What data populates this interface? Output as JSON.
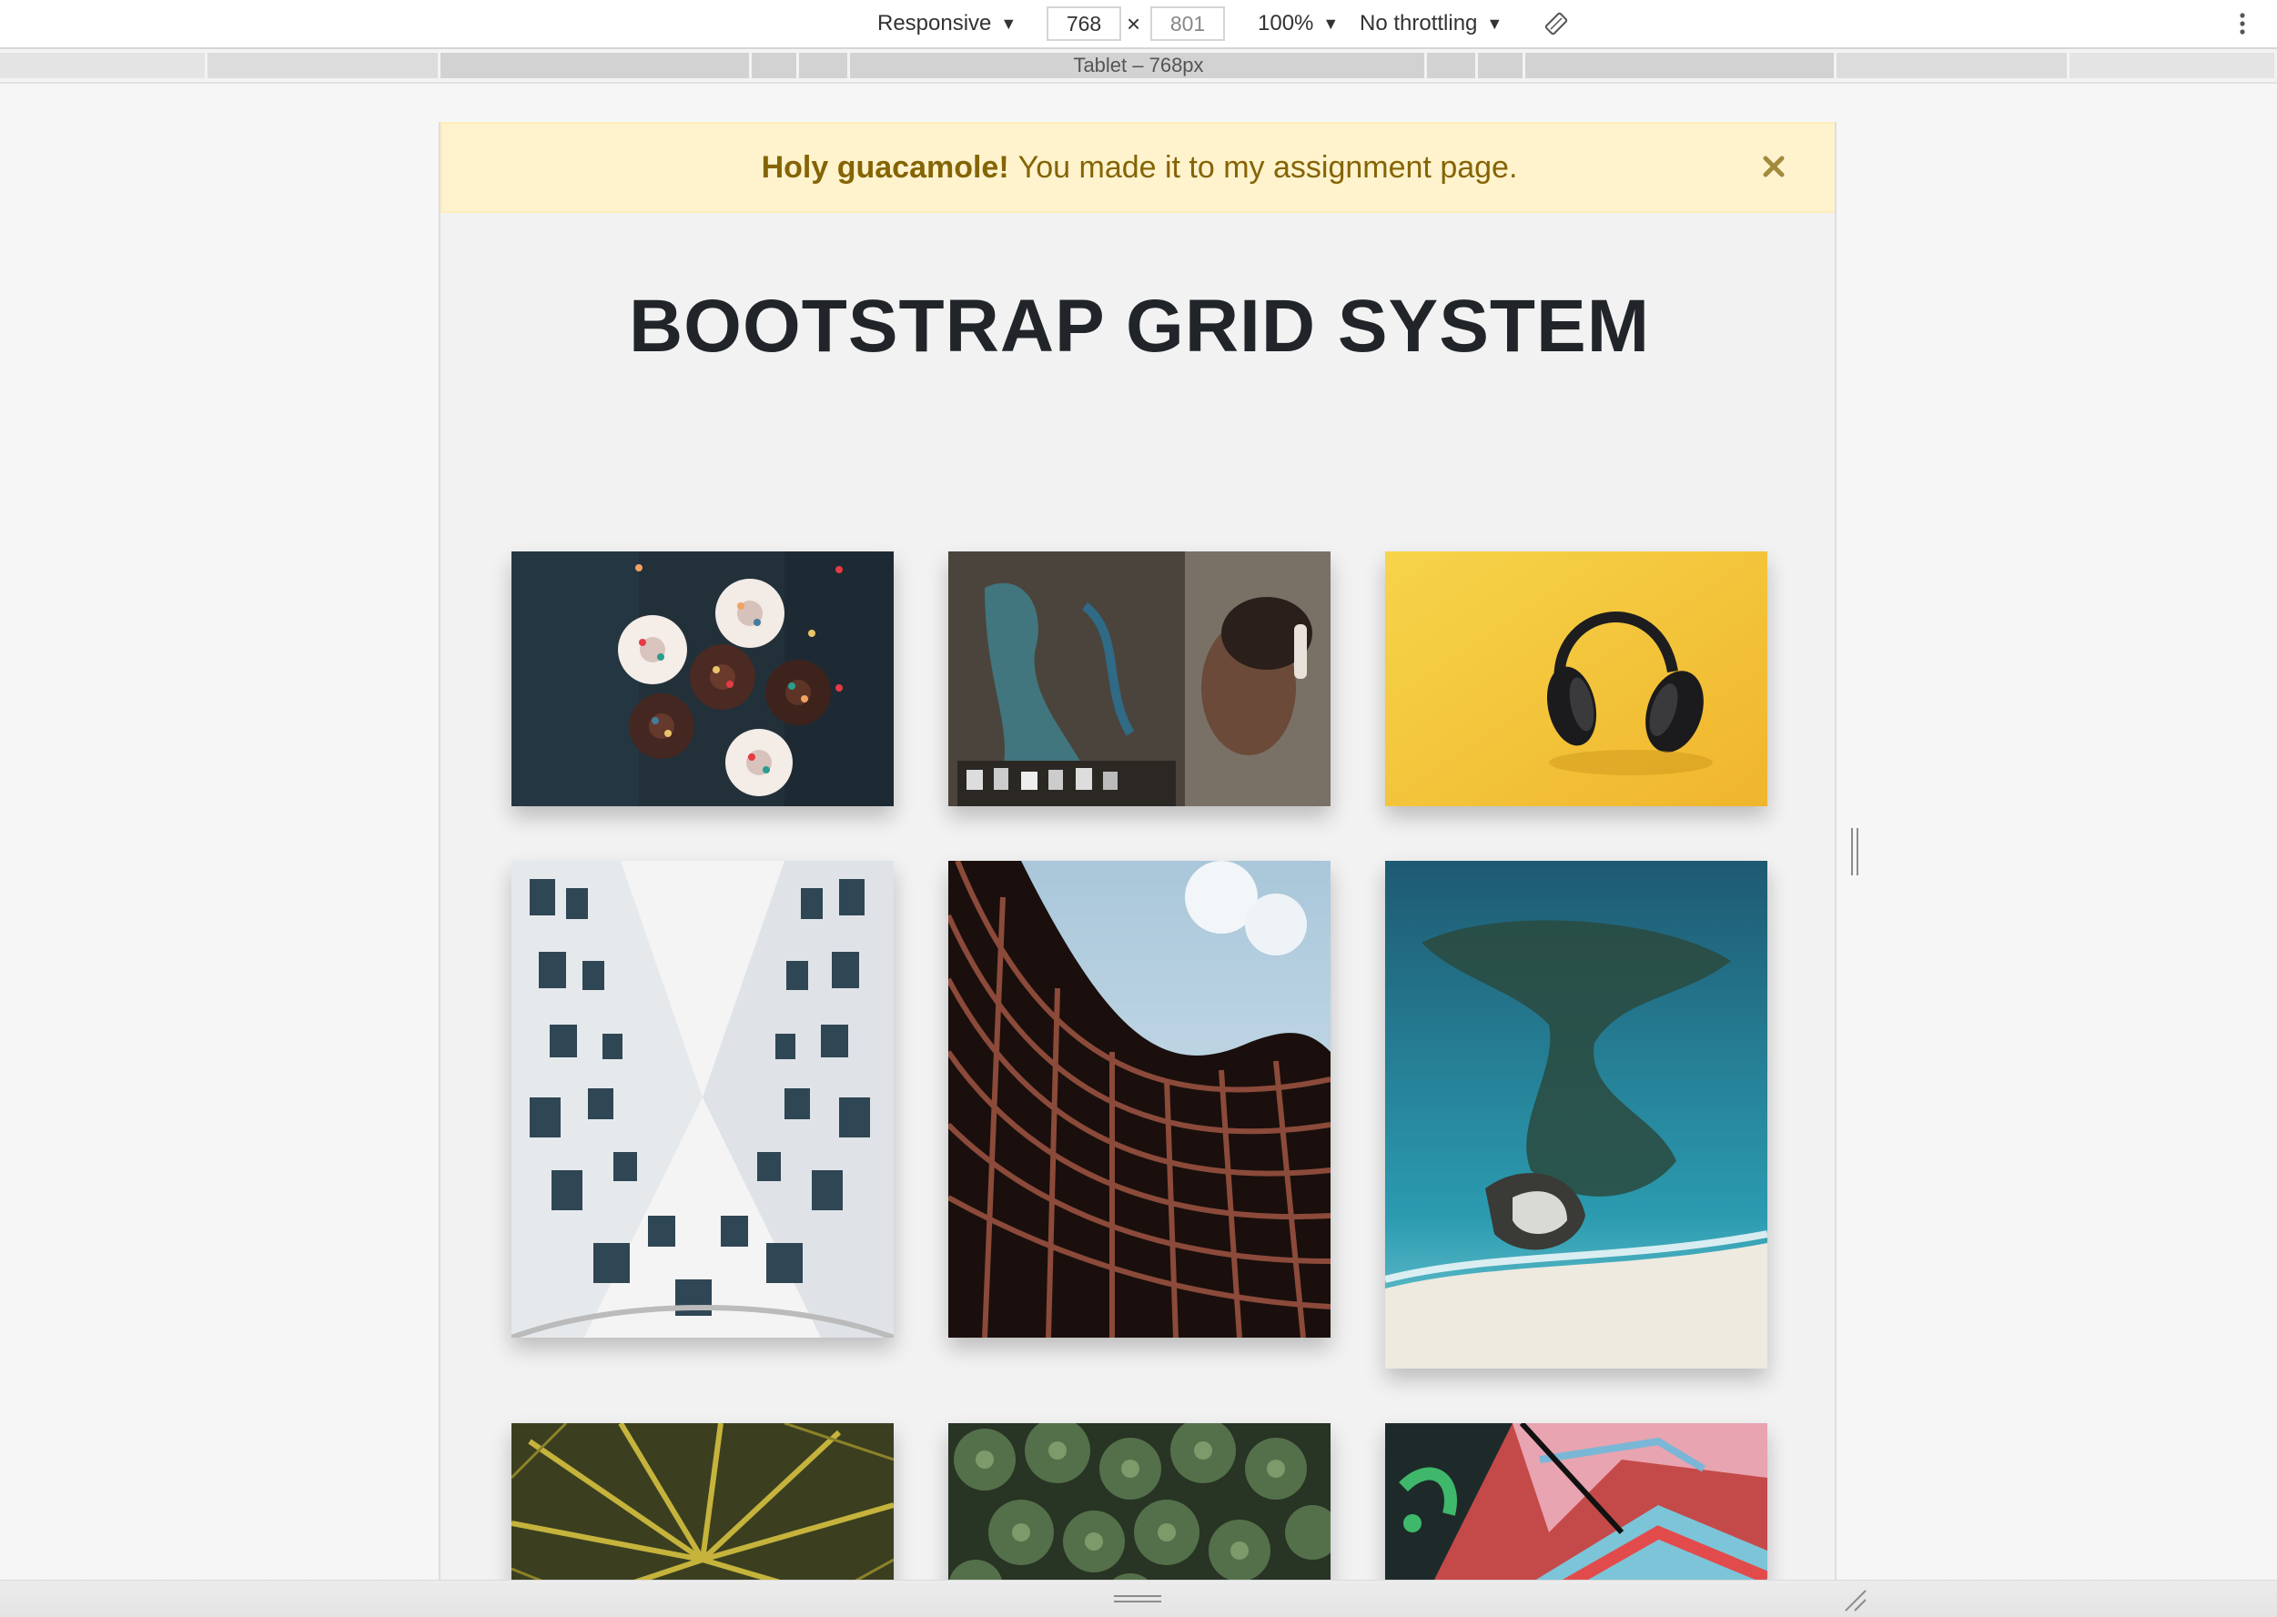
{
  "devtools": {
    "device_mode": "Responsive",
    "width_value": "768",
    "height_value": "801",
    "times_symbol": "×",
    "zoom": "100%",
    "throttling": "No throttling",
    "media_query_label": "Tablet – 768px",
    "icons": [
      "chevron-down-icon",
      "rotate-icon",
      "more-vertical-icon",
      "resize-handle-icon"
    ]
  },
  "page": {
    "alert": {
      "strong": "Holy guacamole!",
      "text": "You made it to my assignment page.",
      "close_label": "×",
      "bg_color": "#fff3cd",
      "text_color": "#856404"
    },
    "heading": "BOOTSTRAP GRID SYSTEM",
    "gallery": [
      {
        "name": "cupcakes-photo"
      },
      {
        "name": "graffiti-girl-headphones-photo"
      },
      {
        "name": "headphones-yellow-photo"
      },
      {
        "name": "white-building-lookup-photo"
      },
      {
        "name": "curved-building-photo"
      },
      {
        "name": "aerial-coast-photo"
      },
      {
        "name": "palm-tree-top-photo"
      },
      {
        "name": "palm-forest-photo"
      },
      {
        "name": "graffiti-wall-photo"
      }
    ]
  }
}
